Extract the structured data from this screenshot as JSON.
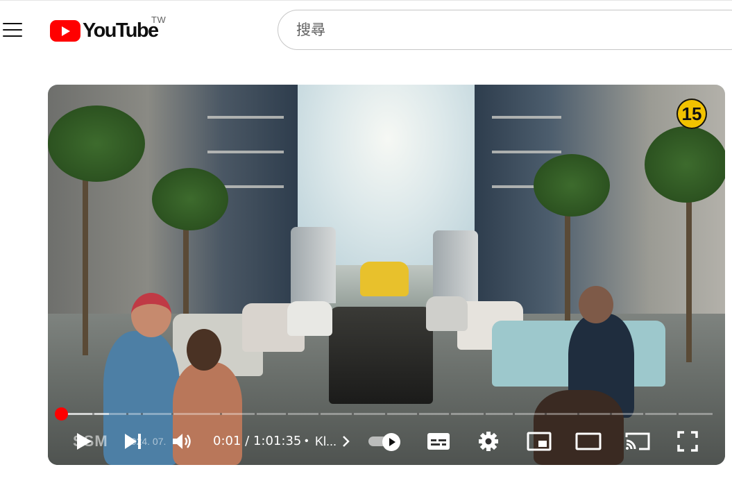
{
  "masthead": {
    "logo_text": "YouTube",
    "country_code": "TW",
    "search_placeholder": "搜尋"
  },
  "player": {
    "content_rating": "15",
    "current_time": "0:01",
    "time_separator": "/",
    "duration": "1:01:35",
    "chapter_separator": "•",
    "chapter_title": "Kl...",
    "progress_fraction": 0.0,
    "watermark_text": "SSM",
    "watermark_date": "2024. 07.",
    "controls": {
      "play": "play-icon",
      "next": "next-icon",
      "volume": "volume-icon",
      "autoplay": "autoplay-toggle",
      "subtitles": "subtitles-icon",
      "settings": "gear-icon",
      "miniplayer": "miniplayer-icon",
      "theater": "theater-icon",
      "cast": "cast-icon",
      "fullscreen": "fullscreen-icon"
    }
  }
}
